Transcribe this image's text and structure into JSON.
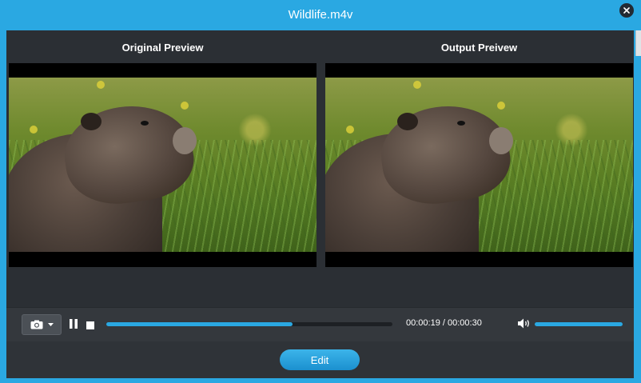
{
  "window": {
    "title": "Wildlife.m4v"
  },
  "preview": {
    "original_label": "Original Preview",
    "output_label": "Output Preivew"
  },
  "controls": {
    "time_current": "00:00:19",
    "time_total": "00:00:30",
    "time_display": "00:00:19 / 00:00:30",
    "progress_percent": 65,
    "volume_percent": 100
  },
  "actions": {
    "edit_label": "Edit"
  },
  "icons": {
    "close": "close-icon",
    "camera": "camera-icon",
    "dropdown": "chevron-down-icon",
    "pause": "pause-icon",
    "stop": "stop-icon",
    "volume": "volume-icon"
  },
  "colors": {
    "accent": "#2aa8e2",
    "panel": "#2f3338",
    "track": "#1d2024"
  }
}
